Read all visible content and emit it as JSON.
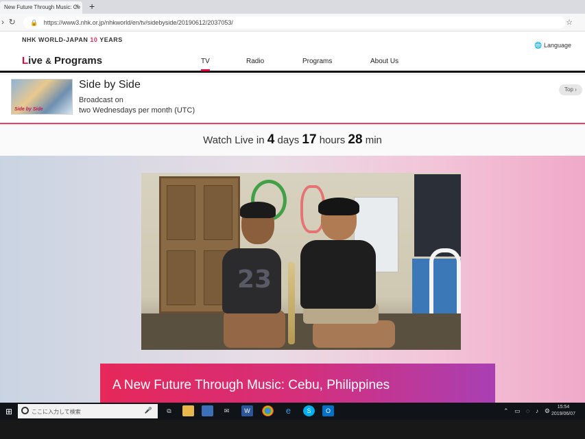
{
  "browser": {
    "tab_title": "New Future Through Music: Ce",
    "tab_close": "×",
    "new_tab": "+",
    "url": "https://www3.nhk.or.jp/nhkworld/en/tv/sidebyside/20190612/2037053/"
  },
  "header": {
    "logo_nhk": "NHK WORLD-JAPAN",
    "logo_years_num": "10",
    "logo_years": "YEARS",
    "language": "Language",
    "brand_first": "L",
    "brand_rest": "ive",
    "brand_amp": "&",
    "brand_programs": "Programs",
    "nav": [
      {
        "label": "TV",
        "active": true
      },
      {
        "label": "Radio",
        "active": false
      },
      {
        "label": "Programs",
        "active": false
      },
      {
        "label": "About Us",
        "active": false
      }
    ]
  },
  "program": {
    "thumb_text": "Side by Side",
    "title": "Side by Side",
    "broadcast_label": "Broadcast on",
    "broadcast_schedule": "two Wednesdays per month (UTC)",
    "top_button": "Top"
  },
  "watch_live": {
    "prefix": "Watch Live in",
    "days": "4",
    "days_label": "days",
    "hours": "17",
    "hours_label": "hours",
    "minutes": "28",
    "minutes_label": "min"
  },
  "episode": {
    "title": "A New Future Through Music: Cebu, Philippines",
    "shirt_number": "23"
  },
  "taskbar": {
    "search_placeholder": "ここに入力して検索",
    "clock_time": "15:54",
    "clock_date": "2019/06/07",
    "pinned": [
      "task-view",
      "file-explorer",
      "store",
      "mail",
      "word",
      "chrome",
      "edge",
      "skype",
      "outlook"
    ]
  },
  "colors": {
    "accent": "#e4003a",
    "caption_gradient_start": "#e6285a",
    "caption_gradient_end": "#a93fb3"
  }
}
